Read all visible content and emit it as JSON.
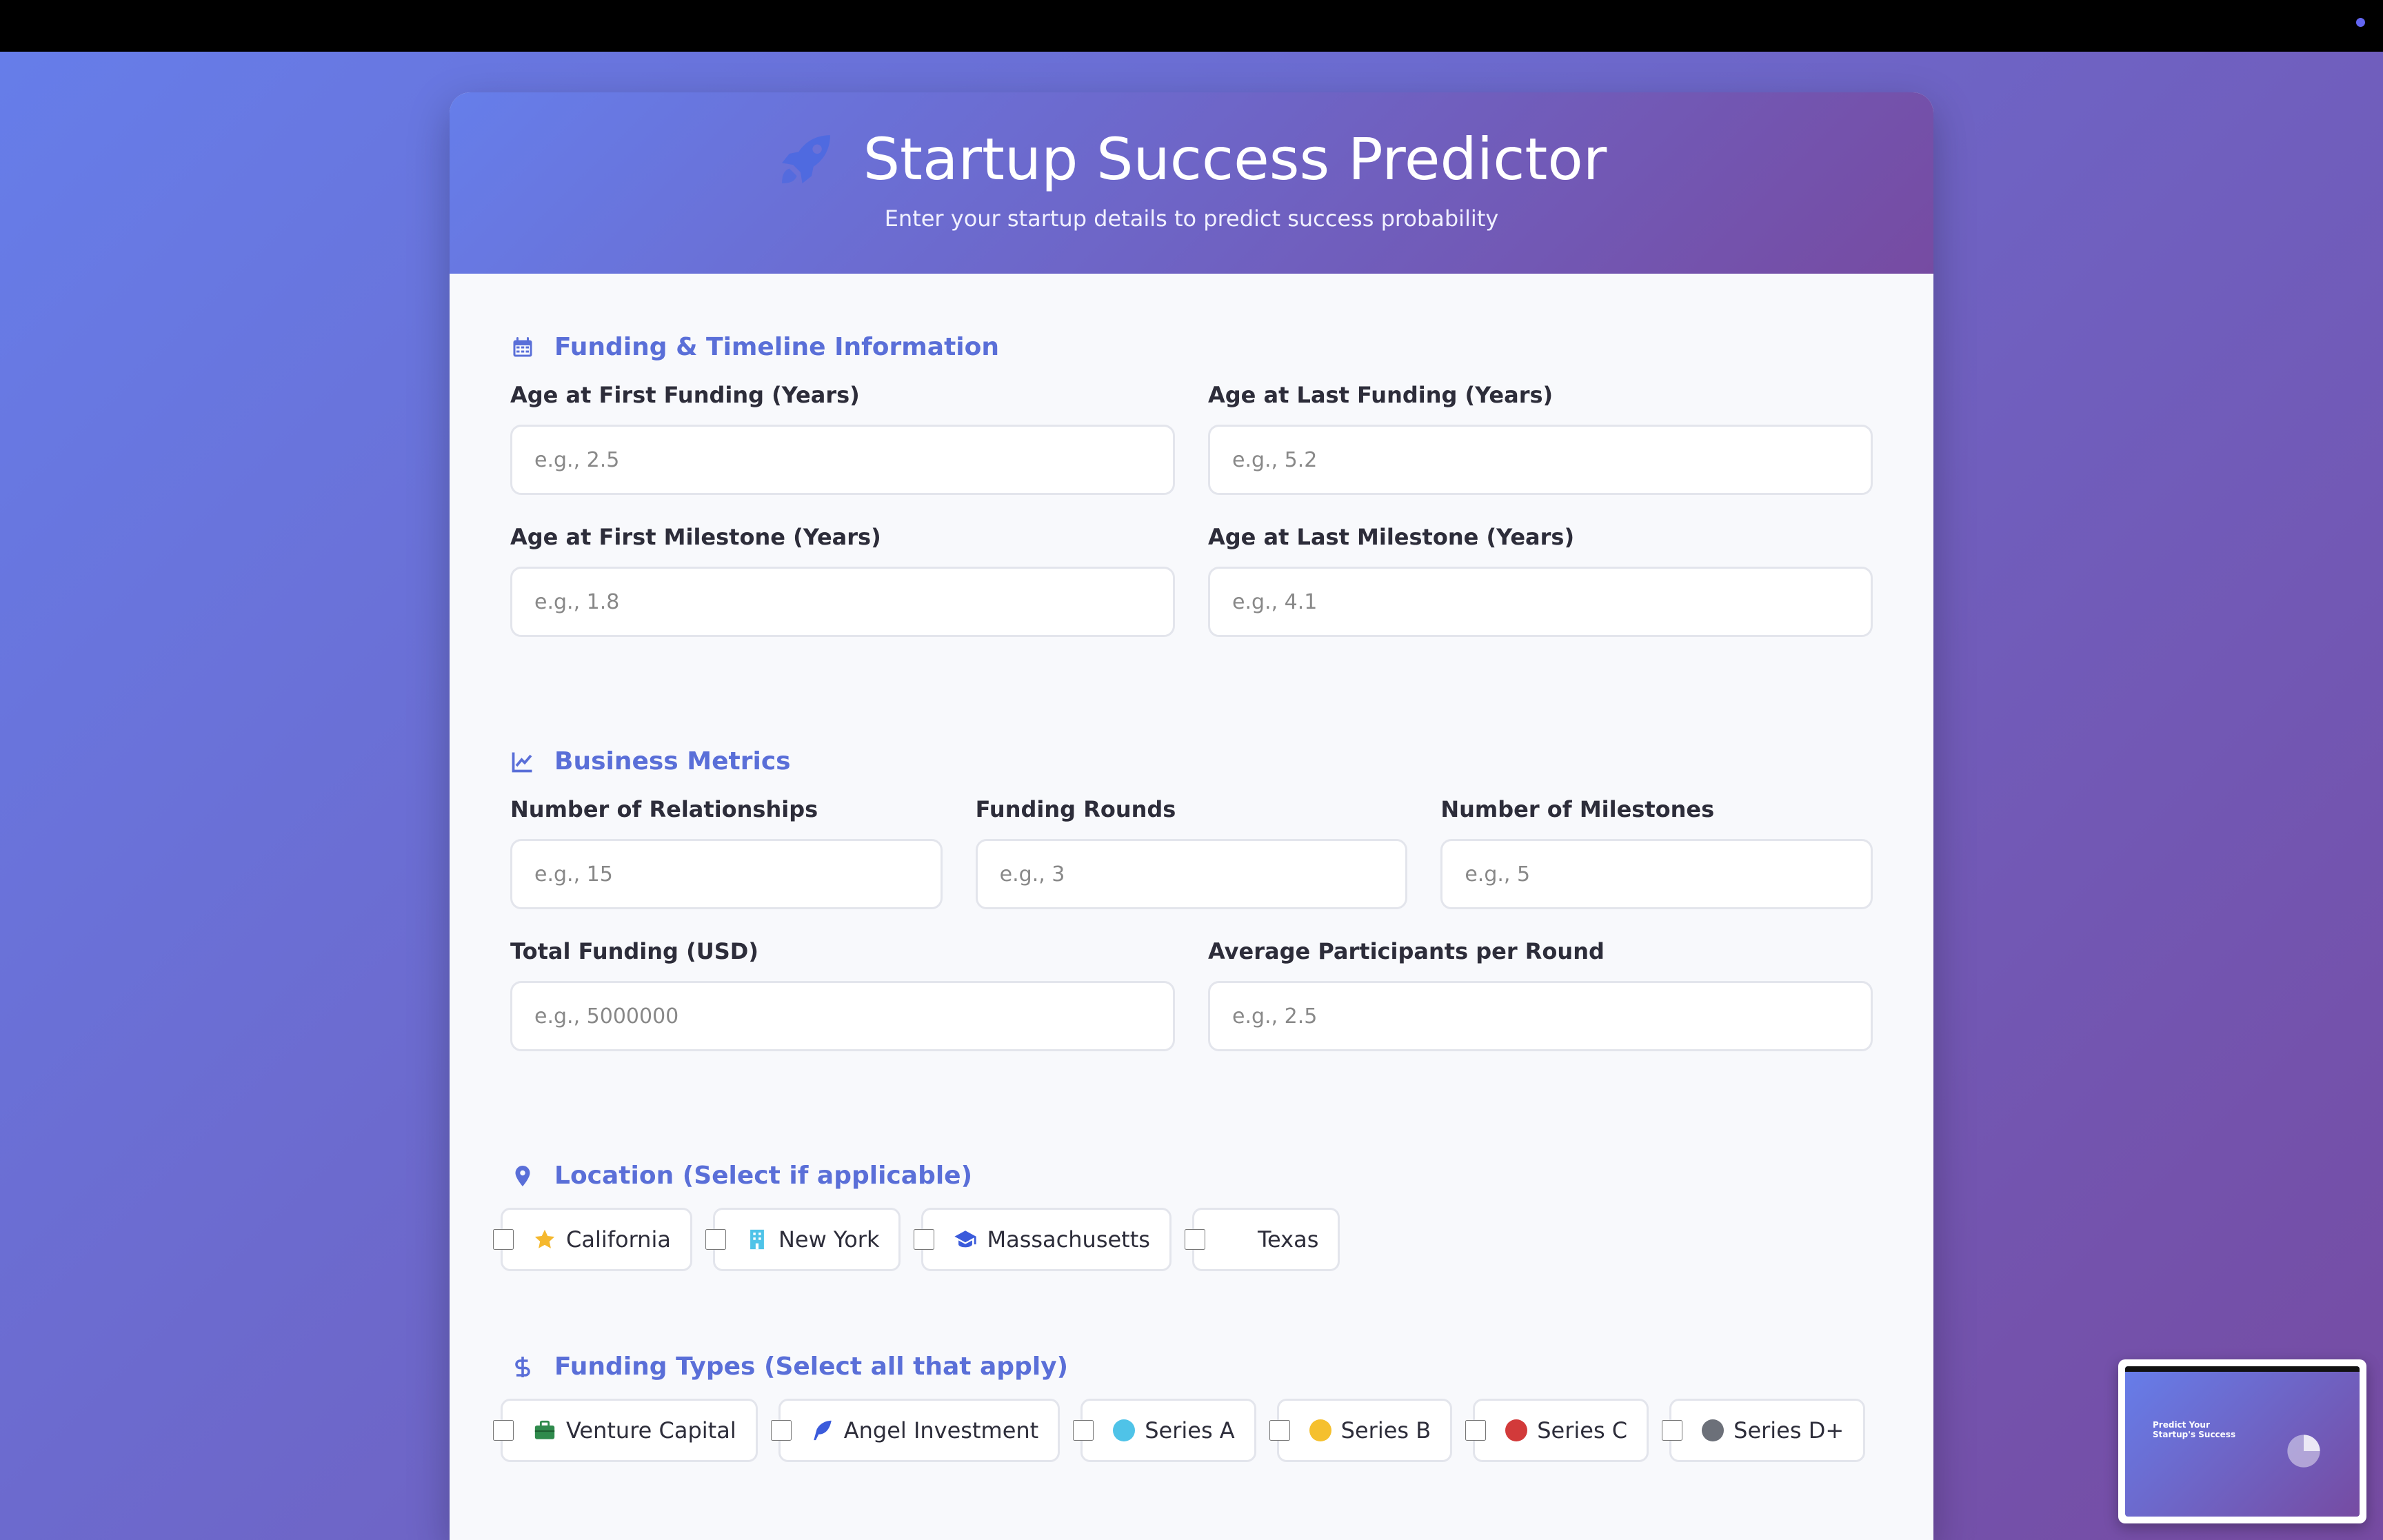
{
  "header": {
    "title": "Startup Success Predictor",
    "subtitle": "Enter your startup details to predict success probability",
    "icon": "rocket-icon"
  },
  "sections": {
    "funding": {
      "title": "Funding & Timeline Information",
      "icon": "calendar-icon",
      "fields": [
        {
          "label": "Age at First Funding (Years)",
          "placeholder": "e.g., 2.5"
        },
        {
          "label": "Age at Last Funding (Years)",
          "placeholder": "e.g., 5.2"
        },
        {
          "label": "Age at First Milestone (Years)",
          "placeholder": "e.g., 1.8"
        },
        {
          "label": "Age at Last Milestone (Years)",
          "placeholder": "e.g., 4.1"
        }
      ]
    },
    "business": {
      "title": "Business Metrics",
      "icon": "line-chart-icon",
      "fields": [
        {
          "label": "Number of Relationships",
          "placeholder": "e.g., 15"
        },
        {
          "label": "Funding Rounds",
          "placeholder": "e.g., 3"
        },
        {
          "label": "Number of Milestones",
          "placeholder": "e.g., 5"
        },
        {
          "label": "Total Funding (USD)",
          "placeholder": "e.g., 5000000"
        },
        {
          "label": "Average Participants per Round",
          "placeholder": "e.g., 2.5"
        }
      ]
    },
    "location": {
      "title": "Location (Select if applicable)",
      "icon": "map-pin-icon",
      "options": [
        {
          "label": "California",
          "icon": "star-icon"
        },
        {
          "label": "New York",
          "icon": "building-icon"
        },
        {
          "label": "Massachusetts",
          "icon": "graduation-cap-icon"
        },
        {
          "label": "Texas",
          "icon": "none"
        }
      ]
    },
    "funding_types": {
      "title": "Funding Types (Select all that apply)",
      "icon": "dollar-icon",
      "options": [
        {
          "label": "Venture Capital",
          "icon": "briefcase-icon"
        },
        {
          "label": "Angel Investment",
          "icon": "feather-icon"
        },
        {
          "label": "Series A",
          "icon": "circle-icon",
          "color": "#4fc3e8"
        },
        {
          "label": "Series B",
          "icon": "circle-icon",
          "color": "#f5c02e"
        },
        {
          "label": "Series C",
          "icon": "circle-icon",
          "color": "#d23a3a"
        },
        {
          "label": "Series D+",
          "icon": "circle-icon",
          "color": "#6c7079"
        }
      ]
    }
  },
  "thumbnail": {
    "title": "Predict Your Startup's Success"
  },
  "colors": {
    "accent": "#5a6fd8",
    "gradient_start": "#667eea",
    "gradient_end": "#764ba2"
  }
}
